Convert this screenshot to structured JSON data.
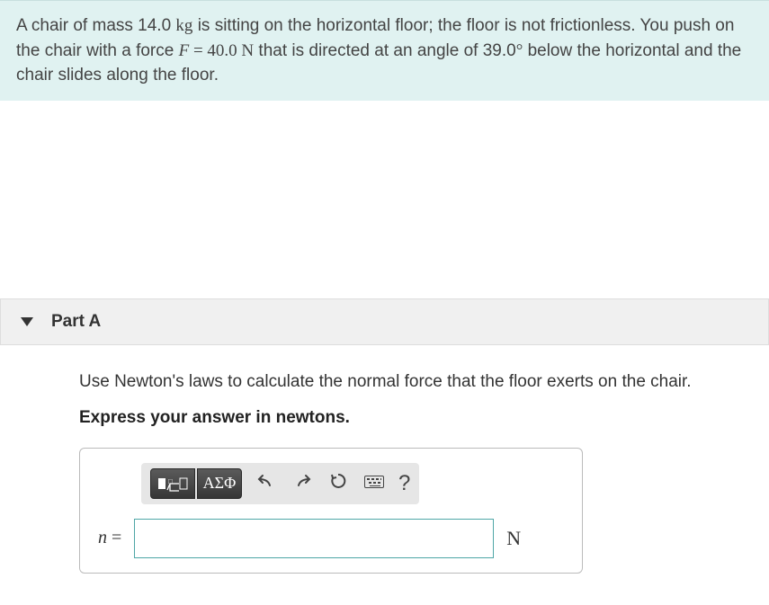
{
  "problem": {
    "text_prefix": "A chair of mass 14.0 ",
    "mass_unit": "kg",
    "text_mid1": " is sitting on the horizontal floor; the floor is not frictionless. You push on the chair with a force ",
    "force_var": "F",
    "equals": " = 40.0 ",
    "force_unit": "N",
    "text_mid2": " that is directed at an angle of 39.0",
    "degree": "°",
    "text_end": " below the horizontal and the chair slides along the floor."
  },
  "part": {
    "label": "Part A",
    "instruction": "Use Newton's laws to calculate the normal force that the floor exerts on the chair.",
    "directive": "Express your answer in newtons."
  },
  "toolbar": {
    "templates_label": "▮√▢",
    "greek_label": "ΑΣΦ",
    "help_label": "?"
  },
  "answer": {
    "variable": "n",
    "equals": " =",
    "value": "",
    "unit": "N"
  }
}
